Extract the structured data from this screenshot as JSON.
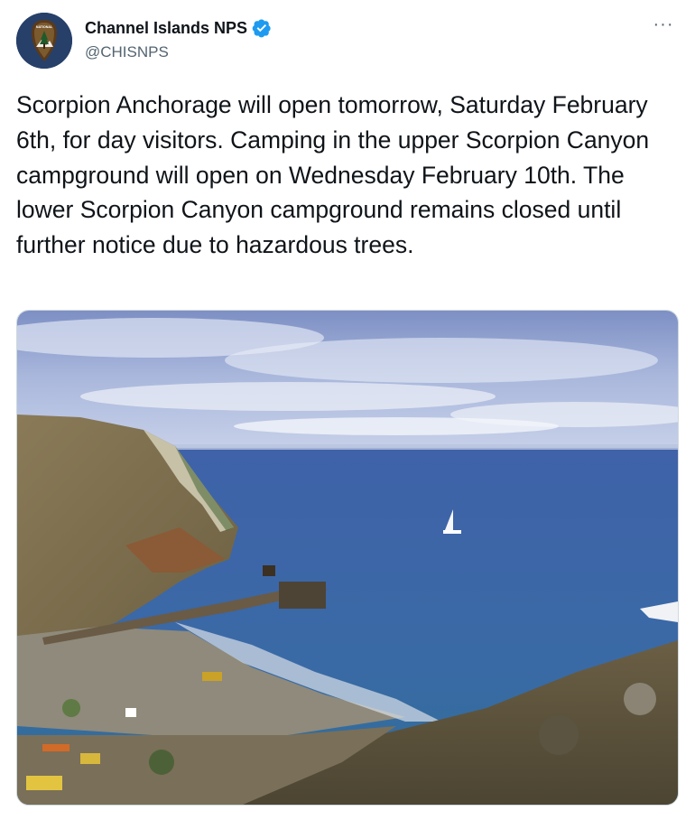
{
  "tweet": {
    "author": {
      "name": "Channel Islands NPS",
      "handle": "@CHISNPS",
      "verified": true,
      "avatar_icon": "nps-arrowhead-logo",
      "avatar_text": [
        "NATIONAL",
        "PARK",
        "SERVICE"
      ]
    },
    "more_icon": "more-options-icon",
    "more_label": "···",
    "text": "Scorpion Anchorage will open tomorrow, Saturday February 6th, for day visitors. Camping in the upper Scorpion Canyon campground will open on  Wednesday February 10th.  The lower Scorpion Canyon campground remains closed until further notice due to hazardous trees.",
    "media": {
      "type": "photo",
      "icon": "coastal-photo"
    }
  },
  "colors": {
    "verified": "#1d9bf0",
    "handle": "#536471",
    "text": "#0f1419"
  }
}
